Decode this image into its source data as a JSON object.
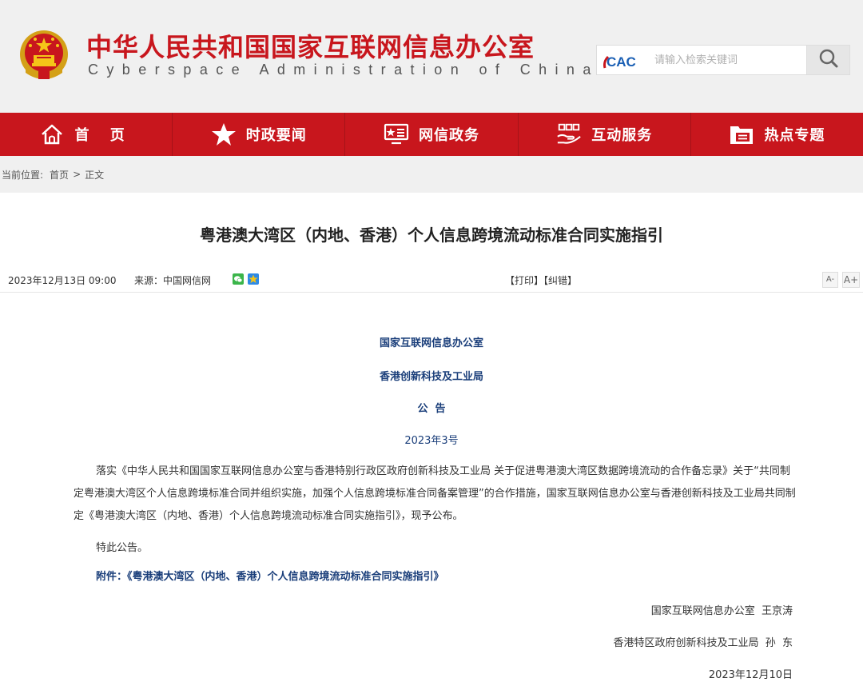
{
  "header": {
    "title": "中华人民共和国国家互联网信息办公室",
    "subtitle": "Cyberspace Administration of China",
    "emblem_icon": "national-emblem-icon",
    "cac_logo_text": "CAC",
    "brand_red": "#c8161d"
  },
  "search": {
    "placeholder": "请输入检索关键词",
    "icon": "search-icon"
  },
  "nav": {
    "items": [
      {
        "label": "首 页",
        "icon": "home-icon"
      },
      {
        "label": "时政要闻",
        "icon": "star-icon"
      },
      {
        "label": "网信政务",
        "icon": "government-screen-icon"
      },
      {
        "label": "互动服务",
        "icon": "handshake-service-icon"
      },
      {
        "label": "热点专题",
        "icon": "topic-folder-icon"
      }
    ]
  },
  "breadcrumb": {
    "prefix": "当前位置:",
    "home": "首页",
    "separator": ">",
    "current": "正文"
  },
  "article": {
    "title": "粤港澳大湾区（内地、香港）个人信息跨境流动标准合同实施指引",
    "date": "2023年12月13日 09:00",
    "source_label": "来源：",
    "source": "中国网信网",
    "share_icons": [
      "wechat-icon",
      "qzone-icon"
    ],
    "print_label": "【打印】",
    "correct_label": "【纠错】",
    "font_small_label": "A-",
    "font_large_label": "A+",
    "issuer_1": "国家互联网信息办公室",
    "issuer_2": "香港创新科技及工业局",
    "doc_type": "公  告",
    "doc_number": "2023年3号",
    "paragraph": "落实《中华人民共和国国家互联网信息办公室与香港特别行政区政府创新科技及工业局  关于促进粤港澳大湾区数据跨境流动的合作备忘录》关于“共同制定粤港澳大湾区个人信息跨境标准合同并组织实施，加强个人信息跨境标准合同备案管理”的合作措施，国家互联网信息办公室与香港创新科技及工业局共同制定《粤港澳大湾区（内地、香港）个人信息跨境流动标准合同实施指引》，现予公布。",
    "closing": "特此公告。",
    "attachment": "附件：《粤港澳大湾区（内地、香港）个人信息跨境流动标准合同实施指引》",
    "signature_1": "国家互联网信息办公室  王京涛",
    "signature_2": "香港特区政府创新科技及工业局  孙  东",
    "sign_date": "2023年12月10日"
  }
}
